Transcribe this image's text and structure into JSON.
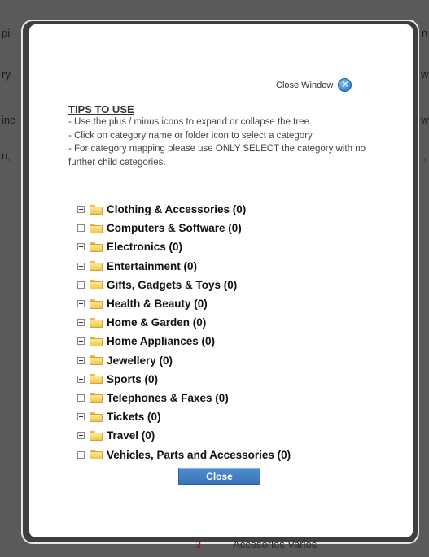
{
  "background": {
    "fragments": [
      {
        "text": "pi",
        "id": "frag-1"
      },
      {
        "text": "ry",
        "id": "frag-2"
      },
      {
        "text": "inc",
        "id": "frag-3"
      },
      {
        "text": "n,",
        "id": "frag-4"
      },
      {
        "text": "n",
        "id": "frag-5"
      },
      {
        "text": "w",
        "id": "frag-6"
      },
      {
        "text": "w",
        "id": "frag-7"
      },
      {
        "text": ",",
        "id": "frag-8"
      }
    ],
    "footer_num": "3",
    "footer_text": "Accesorios Varios"
  },
  "modal": {
    "close_window_label": "Close Window",
    "close_window_icon": "close-icon",
    "tips_title": "TIPS TO USE",
    "tips_lines": [
      "- Use the plus / minus icons to expand or collapse the tree.",
      "- Click on category name or folder icon to select a category.",
      "- For category mapping please use ONLY SELECT the category with no further child categories."
    ],
    "categories": [
      "Clothing & Accessories (0)",
      "Computers & Software (0)",
      "Electronics (0)",
      "Entertainment (0)",
      "Gifts, Gadgets & Toys (0)",
      "Health & Beauty (0)",
      "Home & Garden (0)",
      "Home Appliances (0)",
      "Jewellery (0)",
      "Sports (0)",
      "Telephones & Faxes (0)",
      "Tickets (0)",
      "Travel (0)",
      "Vehicles, Parts and Accessories (0)"
    ],
    "close_button_label": "Close"
  },
  "colors": {
    "overlay": "#5a5a5a",
    "modal_border": "#e8e8e8",
    "close_button": "#3a74b6",
    "folder": "#f2c84b"
  }
}
